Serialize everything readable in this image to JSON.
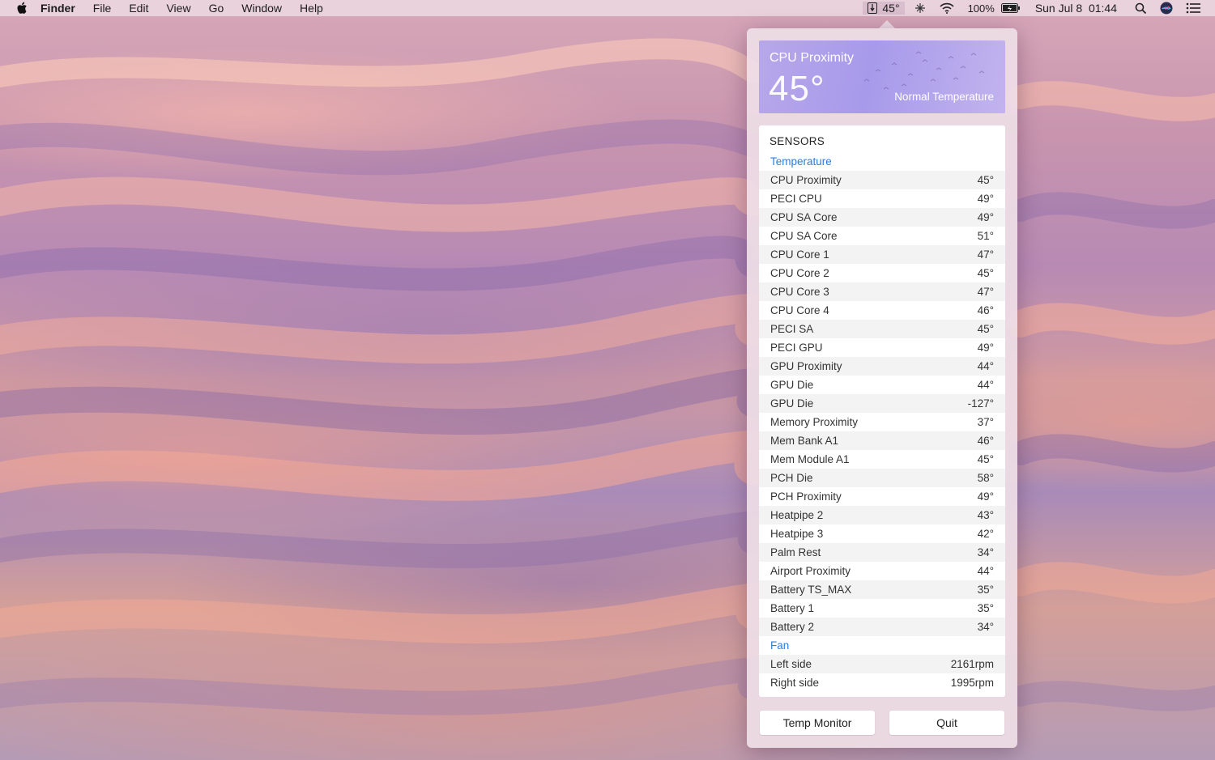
{
  "menubar": {
    "app_name": "Finder",
    "menus": [
      "File",
      "Edit",
      "View",
      "Go",
      "Window",
      "Help"
    ],
    "temp_reading": "45°",
    "battery_percent": "100%",
    "datetime": "Sun Jul 8  01:44"
  },
  "popover": {
    "hero": {
      "sensor_name": "CPU Proximity",
      "temperature": "45°",
      "status": "Normal Temperature",
      "gradient_start": "#b7a7ea",
      "gradient_end": "#c2b3ee"
    },
    "sensors_title": "SENSORS",
    "sections": [
      {
        "title": "Temperature",
        "rows": [
          {
            "label": "CPU Proximity",
            "value": "45°"
          },
          {
            "label": "PECI CPU",
            "value": "49°"
          },
          {
            "label": "CPU SA Core",
            "value": "49°"
          },
          {
            "label": "CPU SA Core",
            "value": "51°"
          },
          {
            "label": "CPU Core 1",
            "value": "47°"
          },
          {
            "label": "CPU Core 2",
            "value": "45°"
          },
          {
            "label": "CPU Core 3",
            "value": "47°"
          },
          {
            "label": "CPU Core 4",
            "value": "46°"
          },
          {
            "label": "PECI SA",
            "value": "45°"
          },
          {
            "label": "PECI GPU",
            "value": "49°"
          },
          {
            "label": "GPU Proximity",
            "value": "44°"
          },
          {
            "label": "GPU Die",
            "value": "44°"
          },
          {
            "label": "GPU Die",
            "value": "-127°"
          },
          {
            "label": "Memory Proximity",
            "value": "37°"
          },
          {
            "label": "Mem Bank A1",
            "value": "46°"
          },
          {
            "label": "Mem Module A1",
            "value": "45°"
          },
          {
            "label": "PCH Die",
            "value": "58°"
          },
          {
            "label": "PCH Proximity",
            "value": "49°"
          },
          {
            "label": "Heatpipe 2",
            "value": "43°"
          },
          {
            "label": "Heatpipe 3",
            "value": "42°"
          },
          {
            "label": "Palm Rest",
            "value": "34°"
          },
          {
            "label": "Airport Proximity",
            "value": "44°"
          },
          {
            "label": "Battery TS_MAX",
            "value": "35°"
          },
          {
            "label": "Battery 1",
            "value": "35°"
          },
          {
            "label": "Battery 2",
            "value": "34°"
          }
        ]
      },
      {
        "title": "Fan",
        "rows": [
          {
            "label": "Left side",
            "value": "2161rpm"
          },
          {
            "label": "Right side",
            "value": "1995rpm"
          }
        ]
      }
    ],
    "buttons": {
      "monitor_label": "Temp Monitor",
      "quit_label": "Quit"
    },
    "accent_color": "#2a7de1"
  }
}
